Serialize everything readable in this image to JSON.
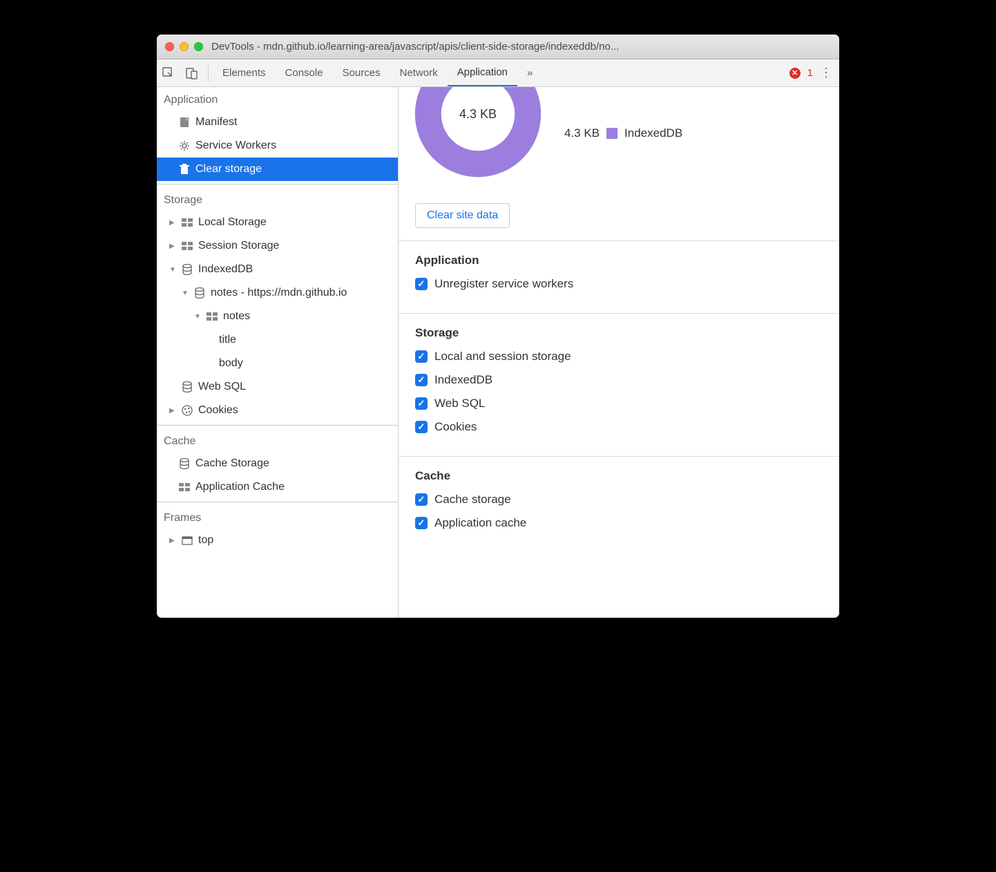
{
  "window": {
    "title": "DevTools - mdn.github.io/learning-area/javascript/apis/client-side-storage/indexeddb/no..."
  },
  "tabs": {
    "items": [
      "Elements",
      "Console",
      "Sources",
      "Network",
      "Application"
    ],
    "active_index": 4,
    "overflow": "»",
    "error_count": "1"
  },
  "sidebar": {
    "application_head": "Application",
    "app_items": [
      "Manifest",
      "Service Workers",
      "Clear storage"
    ],
    "app_selected_index": 2,
    "storage_head": "Storage",
    "local_storage": "Local Storage",
    "session_storage": "Session Storage",
    "indexeddb": "IndexedDB",
    "idb_db": "notes - https://mdn.github.io",
    "idb_store": "notes",
    "idb_key1": "title",
    "idb_key2": "body",
    "websql": "Web SQL",
    "cookies": "Cookies",
    "cache_head": "Cache",
    "cache_storage": "Cache Storage",
    "app_cache": "Application Cache",
    "frames_head": "Frames",
    "frames_top": "top"
  },
  "main": {
    "usage_total": "4.3 KB",
    "legend_value": "4.3 KB",
    "legend_label": "IndexedDB",
    "clear_button": "Clear site data",
    "application_head": "Application",
    "application_opts": [
      "Unregister service workers"
    ],
    "storage_head": "Storage",
    "storage_opts": [
      "Local and session storage",
      "IndexedDB",
      "Web SQL",
      "Cookies"
    ],
    "cache_head": "Cache",
    "cache_opts": [
      "Cache storage",
      "Application cache"
    ]
  },
  "colors": {
    "accent": "#1a73e8",
    "donut": "#9b7ede"
  }
}
